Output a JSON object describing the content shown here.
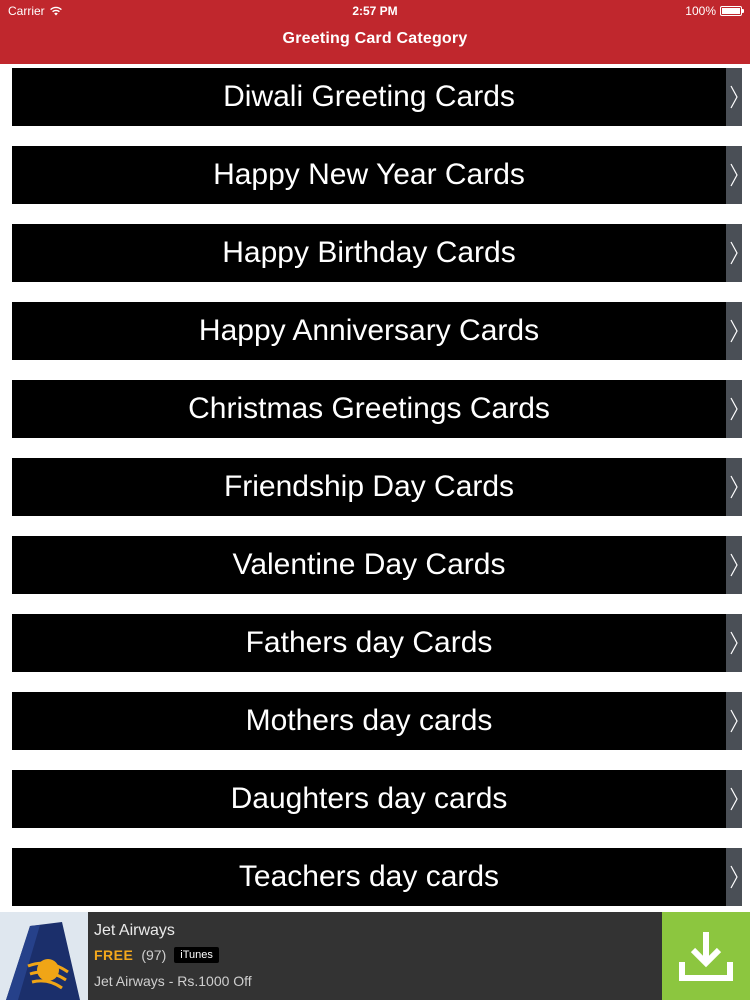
{
  "status_bar": {
    "carrier": "Carrier",
    "time": "2:57 PM",
    "battery": "100%"
  },
  "nav": {
    "title": "Greeting Card Category"
  },
  "categories": [
    {
      "label": "Diwali Greeting Cards"
    },
    {
      "label": "Happy New Year Cards"
    },
    {
      "label": "Happy Birthday Cards"
    },
    {
      "label": "Happy Anniversary Cards"
    },
    {
      "label": "Christmas Greetings Cards"
    },
    {
      "label": "Friendship Day Cards"
    },
    {
      "label": "Valentine Day Cards"
    },
    {
      "label": "Fathers day Cards"
    },
    {
      "label": "Mothers day cards"
    },
    {
      "label": "Daughters day cards"
    },
    {
      "label": "Teachers day cards"
    }
  ],
  "ad": {
    "title": "Jet Airways",
    "price": "FREE",
    "reviews": "(97)",
    "store": "iTunes",
    "subtitle": "Jet Airways - Rs.1000 Off"
  },
  "colors": {
    "nav_bar": "#c0272d",
    "row_background": "#000000",
    "row_accessory": "#4a4f56",
    "ad_background": "#333333",
    "ad_price": "#f4a81c",
    "download_button": "#8cc63f"
  }
}
